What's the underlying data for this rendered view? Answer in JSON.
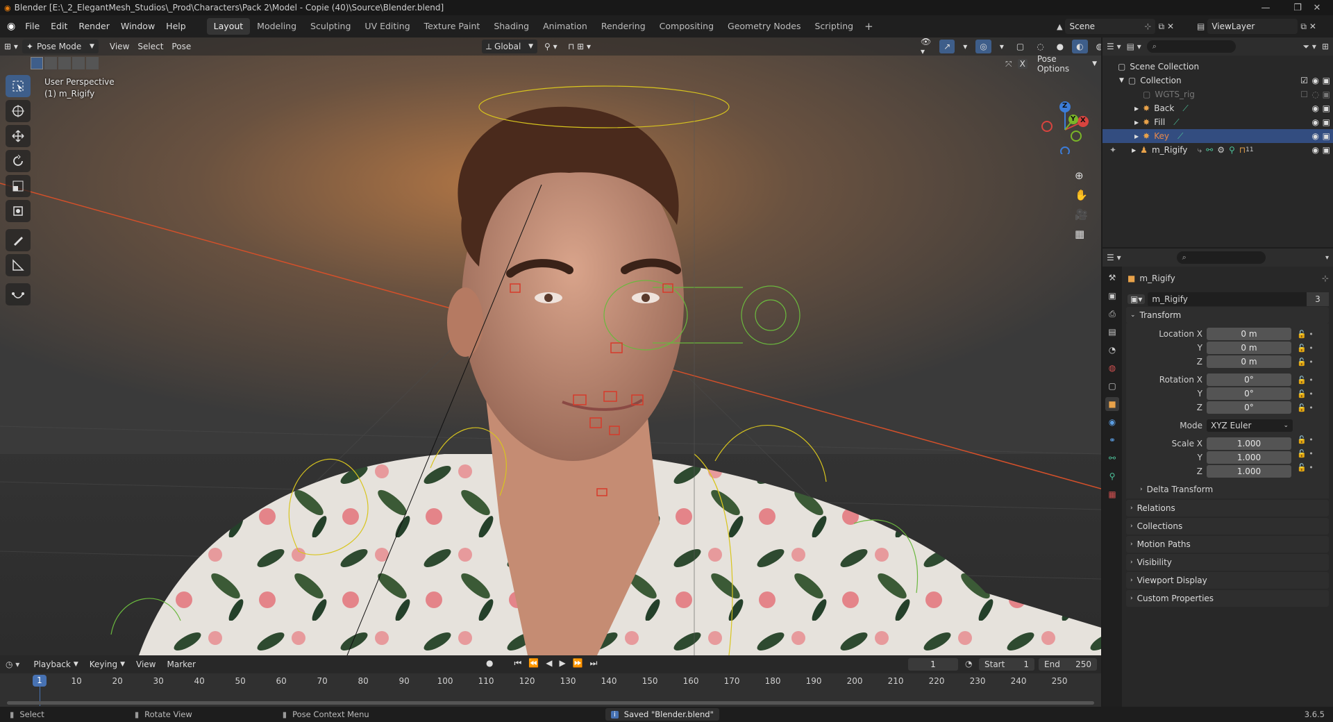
{
  "window": {
    "title": "Blender [E:\\_2_ElegantMesh_Studios\\_Prod\\Characters\\Pack 2\\Model - Copie (40)\\Source\\Blender.blend]"
  },
  "menus": [
    "File",
    "Edit",
    "Render",
    "Window",
    "Help"
  ],
  "workspaces": [
    "Layout",
    "Modeling",
    "Sculpting",
    "UV Editing",
    "Texture Paint",
    "Shading",
    "Animation",
    "Rendering",
    "Compositing",
    "Geometry Nodes",
    "Scripting"
  ],
  "active_workspace": "Layout",
  "scene": {
    "name": "Scene"
  },
  "view_layer": {
    "name": "ViewLayer"
  },
  "viewport": {
    "mode": "Pose Mode",
    "menus": [
      "View",
      "Select",
      "Pose"
    ],
    "transform_orientation": "Global",
    "pose_options": "Pose Options",
    "overlay_text": {
      "line1": "User Perspective",
      "line2": "(1) m_Rigify"
    },
    "gizmo_axes": {
      "z": "Z",
      "y": "Y",
      "x": "X"
    }
  },
  "outliner": {
    "root": "Scene Collection",
    "collection": "Collection",
    "items": [
      {
        "name": "WGTS_rig"
      },
      {
        "name": "Back"
      },
      {
        "name": "Fill"
      },
      {
        "name": "Key"
      },
      {
        "name": "m_Rigify",
        "badge": "11"
      }
    ]
  },
  "properties": {
    "object_name": "m_Rigify",
    "datablock_name": "m_Rigify",
    "datablock_users": "3",
    "transform_title": "Transform",
    "location_label": "Location X",
    "rotation_label": "Rotation X",
    "scale_label": "Scale X",
    "axis_y": "Y",
    "axis_z": "Z",
    "location": [
      "0 m",
      "0 m",
      "0 m"
    ],
    "rotation": [
      "0°",
      "0°",
      "0°"
    ],
    "mode_label": "Mode",
    "mode_value": "XYZ Euler",
    "scale": [
      "1.000",
      "1.000",
      "1.000"
    ],
    "delta_transform": "Delta Transform",
    "panels": [
      "Relations",
      "Collections",
      "Motion Paths",
      "Visibility",
      "Viewport Display",
      "Custom Properties"
    ]
  },
  "timeline": {
    "menus": [
      "Playback",
      "Keying",
      "View",
      "Marker"
    ],
    "current_frame": "1",
    "start_label": "Start",
    "start": "1",
    "end_label": "End",
    "end": "250",
    "ticks": [
      "10",
      "20",
      "30",
      "40",
      "50",
      "60",
      "70",
      "80",
      "90",
      "100",
      "110",
      "120",
      "130",
      "140",
      "150",
      "160",
      "170",
      "180",
      "190",
      "200",
      "210",
      "220",
      "230",
      "240",
      "250"
    ],
    "playhead": "1"
  },
  "status": {
    "select": "Select",
    "rotate": "Rotate View",
    "context": "Pose Context Menu",
    "saved": "Saved \"Blender.blend\"",
    "version": "3.6.5"
  },
  "colors": {
    "accent": "#4772b3",
    "selected_row": "#334d80",
    "active_text": "#e98a4b"
  }
}
